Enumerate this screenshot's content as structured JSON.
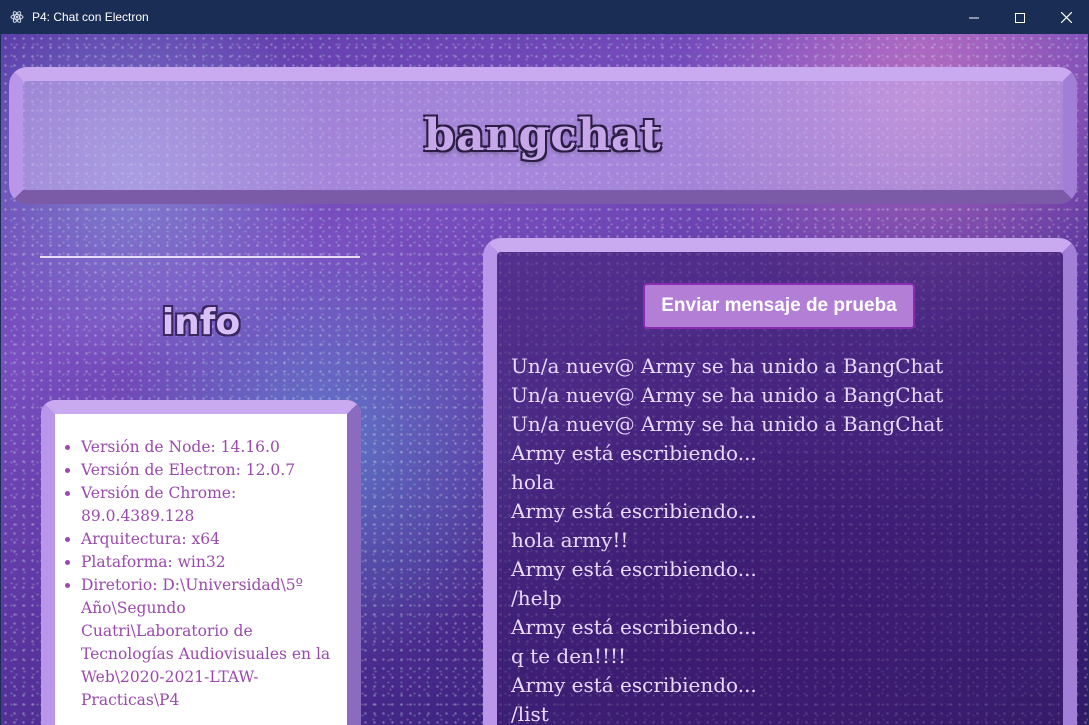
{
  "window": {
    "title": "P4: Chat con Electron",
    "icons": {
      "app": "atom-icon",
      "minimize": "minimize-icon",
      "maximize": "maximize-icon",
      "close": "close-icon"
    }
  },
  "header": {
    "title": "bangchat"
  },
  "info": {
    "title": "info",
    "items": [
      "Versión de Node: 14.16.0",
      "Versión de Electron: 12.0.7",
      "Versión de Chrome: 89.0.4389.128",
      "Arquitectura: x64",
      "Plataforma: win32",
      "Diretorio: D:\\Universidad\\5º Año\\Segundo Cuatri\\Laboratorio de Tecnologías Audiovisuales en la Web\\2020-2021-LTAW-Practicas\\P4"
    ]
  },
  "chat": {
    "send_test_label": "Enviar mensaje de prueba",
    "messages": [
      "Un/a nuev@ Army se ha unido a BangChat",
      "Un/a nuev@ Army se ha unido a BangChat",
      "Un/a nuev@ Army se ha unido a BangChat",
      "Army está escribiendo...",
      "hola",
      "Army está escribiendo...",
      "hola army!!",
      "Army está escribiendo...",
      "/help",
      "Army está escribiendo...",
      "q te den!!!!",
      "Army está escribiendo...",
      "/list"
    ]
  },
  "colors": {
    "titlebar": "#1a2d55",
    "panel_border_light": "#c9aaf0",
    "panel_border_dark": "#7b5aa8",
    "info_text": "#9a4aad",
    "chat_text": "#e9d9ff",
    "button_bg": "#b37fd6",
    "button_border": "#8a2bb0"
  }
}
